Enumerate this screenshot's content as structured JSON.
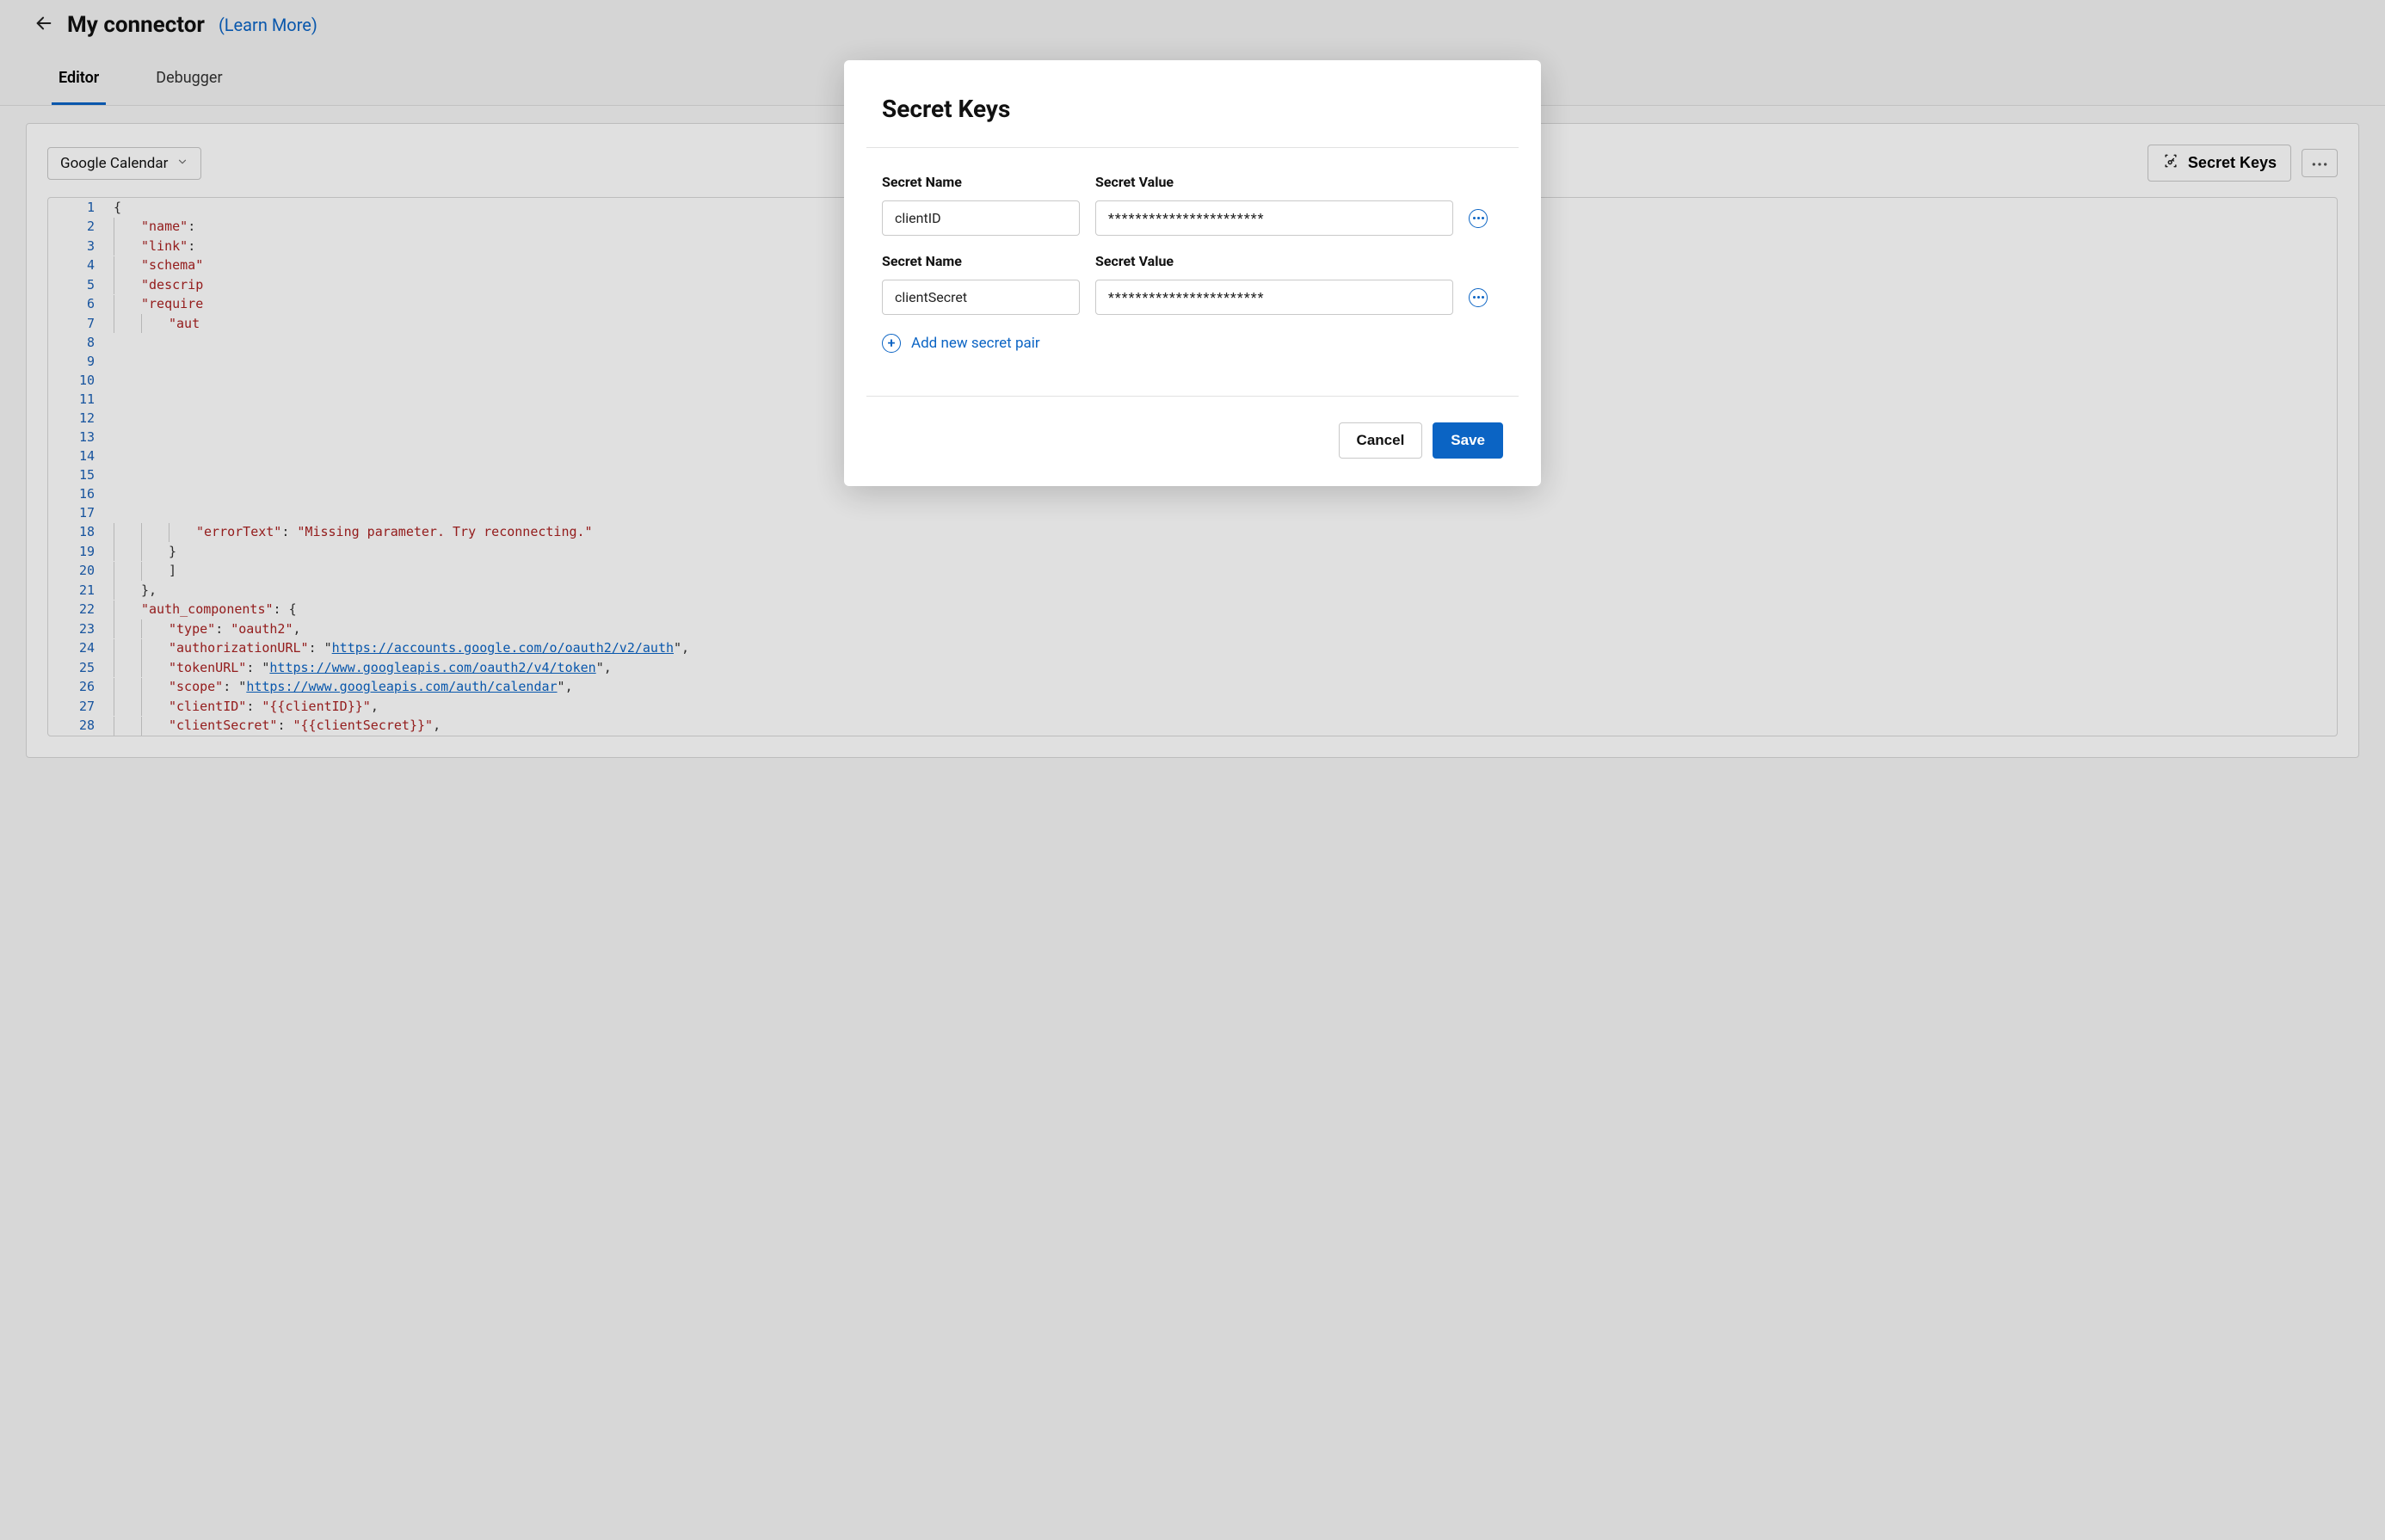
{
  "header": {
    "title": "My connector",
    "learn_more": "(Learn More)"
  },
  "tabs": {
    "editor": "Editor",
    "debugger": "Debugger"
  },
  "toolbar": {
    "dropdown_value": "Google Calendar",
    "secret_keys_btn": "Secret Keys"
  },
  "code": {
    "lines": [
      "{",
      "    \"name\": ",
      "    \"link\": ",
      "    \"schema\"",
      "    \"descrip",
      "    \"require",
      "        \"aut",
      "",
      "",
      "",
      "",
      "",
      "",
      "",
      "",
      "",
      "",
      "            \"errorText\": \"Missing parameter. Try reconnecting.\"",
      "        }",
      "        ]",
      "    },",
      "    \"auth_components\": {",
      "        \"type\": \"oauth2\",",
      "        \"authorizationURL\": \"https://accounts.google.com/o/oauth2/v2/auth\",",
      "        \"tokenURL\": \"https://www.googleapis.com/oauth2/v4/token\",",
      "        \"scope\": \"https://www.googleapis.com/auth/calendar\",",
      "        \"clientID\": \"{{clientID}}\",",
      "        \"clientSecret\": \"{{clientSecret}}\","
    ]
  },
  "modal": {
    "title": "Secret Keys",
    "labels": {
      "name": "Secret Name",
      "value": "Secret Value"
    },
    "pairs": [
      {
        "name": "clientID",
        "value": "***********************"
      },
      {
        "name": "clientSecret",
        "value": "***********************"
      }
    ],
    "add_link": "Add new secret pair",
    "cancel": "Cancel",
    "save": "Save"
  }
}
